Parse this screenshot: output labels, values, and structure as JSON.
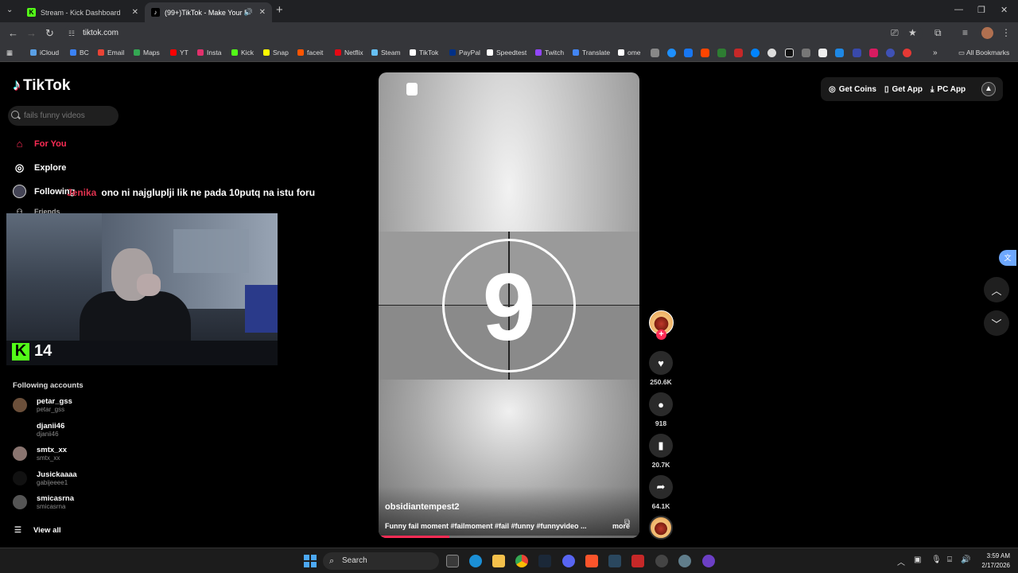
{
  "browser": {
    "tabs": [
      {
        "title": "Stream - Kick Dashboard",
        "favicon": "K"
      },
      {
        "title": "(99+)TikTok - Make Your Da",
        "favicon": "♪"
      }
    ],
    "url": "tiktok.com",
    "bookmarks": [
      {
        "label": "iCloud",
        "color": "#5aa0e6"
      },
      {
        "label": "BC",
        "color": "#3b82f6"
      },
      {
        "label": "Email",
        "color": "#ea4335"
      },
      {
        "label": "Maps",
        "color": "#34a853"
      },
      {
        "label": "YT",
        "color": "#ff0000"
      },
      {
        "label": "Insta",
        "color": "#e1306c"
      },
      {
        "label": "Kick",
        "color": "#53fc18"
      },
      {
        "label": "Snap",
        "color": "#fffc00"
      },
      {
        "label": "faceit",
        "color": "#ff5500"
      },
      {
        "label": "Netflix",
        "color": "#e50914"
      },
      {
        "label": "Steam",
        "color": "#66c0f4"
      },
      {
        "label": "TikTok",
        "color": "#ffffff"
      },
      {
        "label": "PayPal",
        "color": "#003087"
      },
      {
        "label": "Speedtest",
        "color": "#ffffff"
      },
      {
        "label": "Twitch",
        "color": "#9146ff"
      },
      {
        "label": "Translate",
        "color": "#4285f4"
      },
      {
        "label": "ome",
        "color": "#ffffff"
      }
    ],
    "all_bookmarks_label": "All Bookmarks"
  },
  "tiktok": {
    "logo_text": "TikTok",
    "search_placeholder": "fails funny videos",
    "nav": {
      "for_you": "For You",
      "explore": "Explore",
      "following": "Following",
      "friends": "Friends"
    },
    "following_accounts_title": "Following accounts",
    "accounts": [
      {
        "name": "petar_gss",
        "username": "petar_gss"
      },
      {
        "name": "djanii46",
        "username": "djanii46"
      },
      {
        "name": "smtx_xx",
        "username": "smtx_xx"
      },
      {
        "name": "Jusickaaaa",
        "username": "gabijeeee1"
      },
      {
        "name": "smicasrna",
        "username": "smicasrna"
      }
    ],
    "view_all": "View all",
    "top_right": {
      "get_coins": "Get Coins",
      "get_app": "Get App",
      "pc_app": "PC App"
    }
  },
  "stream_overlay": {
    "chat_user": "Jenika",
    "chat_message": "ono ni najgluplji lik ne pada 10putq na istu foru",
    "viewer_count": "14"
  },
  "video": {
    "countdown": "9",
    "author": "obsidiantempest2",
    "caption": "Funny fail moment #failmoment #fail #funny #funnyvideo ...",
    "more": "more",
    "progress": 0.27,
    "likes": "250.6K",
    "comments": "918",
    "saves": "20.7K",
    "shares": "64.1K"
  },
  "taskbar": {
    "search_label": "Search",
    "time": "3:59 AM",
    "date": "2/17/2026"
  }
}
